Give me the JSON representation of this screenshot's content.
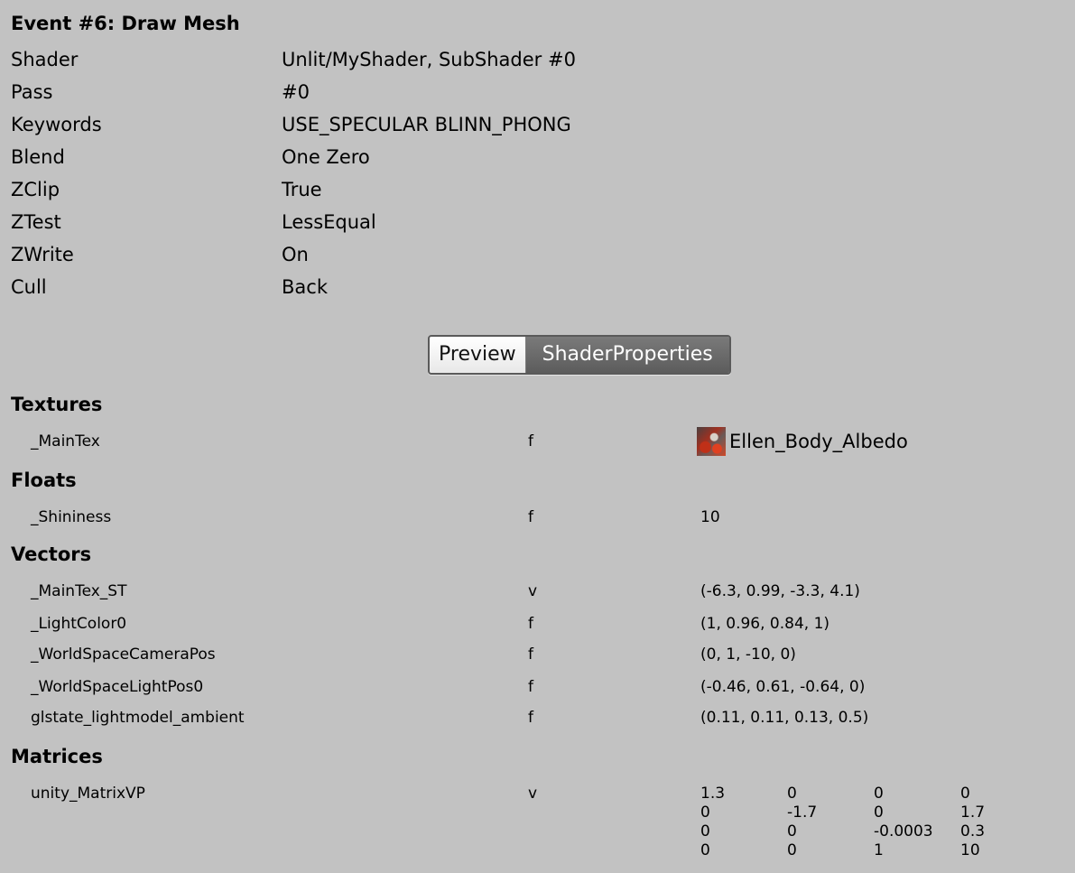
{
  "event_title": "Event #6: Draw Mesh",
  "info": [
    {
      "label": "Shader",
      "value": "Unlit/MyShader, SubShader #0"
    },
    {
      "label": "Pass",
      "value": "#0"
    },
    {
      "label": "Keywords",
      "value": "USE_SPECULAR BLINN_PHONG"
    },
    {
      "label": "Blend",
      "value": "One Zero"
    },
    {
      "label": "ZClip",
      "value": "True"
    },
    {
      "label": "ZTest",
      "value": "LessEqual"
    },
    {
      "label": "ZWrite",
      "value": "On"
    },
    {
      "label": "Cull",
      "value": "Back"
    }
  ],
  "tabs": [
    {
      "label": "Preview",
      "selected": false
    },
    {
      "label": "ShaderProperties",
      "selected": true
    }
  ],
  "sections": {
    "textures": {
      "heading": "Textures",
      "items": [
        {
          "name": "_MainTex",
          "type": "f",
          "value": "Ellen_Body_Albedo"
        }
      ]
    },
    "floats": {
      "heading": "Floats",
      "items": [
        {
          "name": "_Shininess",
          "type": "f",
          "value": "10"
        }
      ]
    },
    "vectors": {
      "heading": "Vectors",
      "items": [
        {
          "name": "_MainTex_ST",
          "type": "v",
          "value": "(-6.3, 0.99, -3.3, 4.1)"
        },
        {
          "name": "_LightColor0",
          "type": "f",
          "value": "(1, 0.96, 0.84, 1)"
        },
        {
          "name": "_WorldSpaceCameraPos",
          "type": "f",
          "value": "(0, 1, -10, 0)"
        },
        {
          "name": "_WorldSpaceLightPos0",
          "type": "f",
          "value": "(-0.46, 0.61, -0.64, 0)"
        },
        {
          "name": "glstate_lightmodel_ambient",
          "type": "f",
          "value": "(0.11, 0.11, 0.13, 0.5)"
        }
      ]
    },
    "matrices": {
      "heading": "Matrices",
      "items": [
        {
          "name": "unity_MatrixVP",
          "type": "v",
          "rows": [
            [
              "1.3",
              "0",
              "0",
              "0"
            ],
            [
              "0",
              "-1.7",
              "0",
              "1.7"
            ],
            [
              "0",
              "0",
              "-0.0003",
              "0.3"
            ],
            [
              "0",
              "0",
              "1",
              "10"
            ]
          ]
        }
      ]
    }
  },
  "texture_icon": "texture-thumbnail-icon"
}
